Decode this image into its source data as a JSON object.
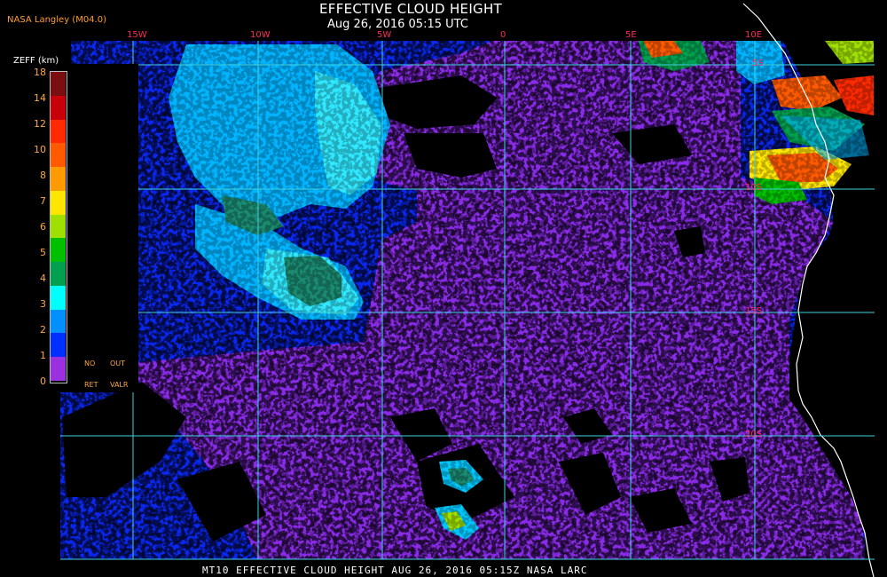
{
  "header": {
    "title": "EFFECTIVE CLOUD HEIGHT",
    "subtitle": "Aug 26, 2016 05:15 UTC",
    "source": "NASA Langley (M04.0)"
  },
  "footer": {
    "caption": "MT10  EFFECTIVE CLOUD HEIGHT  AUG 26, 2016 05:15Z  NASA LARC"
  },
  "legend": {
    "unit_label": "ZEFF (km)",
    "ticks": [
      "18",
      "14",
      "12",
      "10",
      "8",
      "7",
      "6",
      "5",
      "4",
      "3",
      "2",
      "1",
      "0"
    ],
    "colors": [
      "#7a0e10",
      "#c8000a",
      "#ff2a00",
      "#ff5a00",
      "#ff9a00",
      "#ffe600",
      "#a0e000",
      "#00c000",
      "#00a050",
      "#00ffff",
      "#0090ff",
      "#0030ff",
      "#9a30e0"
    ],
    "no_ret_label": [
      "NO",
      "RET"
    ],
    "out_valr_label": [
      "OUT",
      "VALR"
    ]
  },
  "grid": {
    "longitudes": [
      "15W",
      "10W",
      "5W",
      "0",
      "5E",
      "10E"
    ],
    "latitudes": [
      "5S",
      "10S",
      "15S",
      "20S"
    ]
  },
  "colors": {
    "background": "#000000",
    "ocean_clear": "#8a2be8",
    "low_cloud": "#0a28f0",
    "mid_cloud": "#00b4ff",
    "grid_line": "#40d0e0",
    "coast_line": "#ffffff",
    "label_accent": "#ff2a5a"
  }
}
